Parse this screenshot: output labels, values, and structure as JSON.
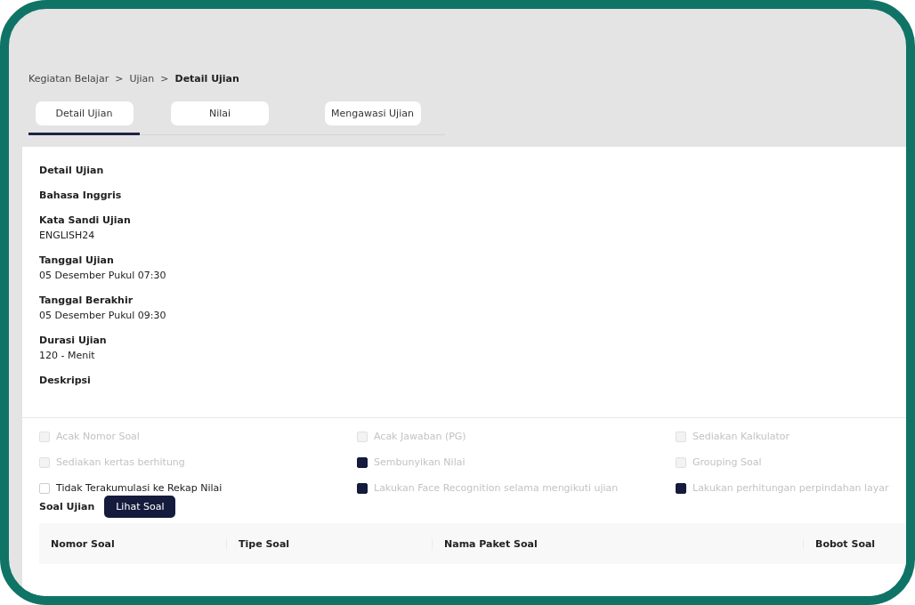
{
  "breadcrumb": [
    {
      "label": "Kegiatan Belajar",
      "current": false
    },
    {
      "label": "Ujian",
      "current": false
    },
    {
      "label": "Detail Ujian",
      "current": true
    }
  ],
  "breadcrumb_separator": ">",
  "tabs": [
    {
      "label": "Detail Ujian",
      "selected": true
    },
    {
      "label": "Nilai",
      "selected": false
    },
    {
      "label": "Mengawasi Ujian",
      "selected": false
    }
  ],
  "detail": {
    "heading": "Detail Ujian",
    "subject": "Bahasa Inggris",
    "fields": [
      {
        "label": "Kata Sandi Ujian",
        "value": "ENGLISH24"
      },
      {
        "label": "Tanggal Ujian",
        "value": "05 Desember Pukul 07:30"
      },
      {
        "label": "Tanggal Berakhir",
        "value": "05 Desember Pukul 09:30"
      },
      {
        "label": "Durasi Ujian",
        "value": "120 - Menit"
      },
      {
        "label": "Deskripsi"
      }
    ]
  },
  "options": [
    {
      "label": "Acak Nomor Soal",
      "checked": false,
      "disabled": true
    },
    {
      "label": "Acak Jawaban (PG)",
      "checked": false,
      "disabled": true
    },
    {
      "label": "Sediakan Kalkulator",
      "checked": false,
      "disabled": true
    },
    {
      "label": "Sediakan kertas berhitung",
      "checked": false,
      "disabled": true
    },
    {
      "label": "Sembunyikan Nilai",
      "checked": true,
      "disabled": true
    },
    {
      "label": "Grouping Soal",
      "checked": false,
      "disabled": true
    },
    {
      "label": "Tidak Terakumulasi ke Rekap Nilai",
      "checked": false,
      "disabled": false
    },
    {
      "label": "Lakukan Face Recognition selama mengikuti ujian",
      "checked": true,
      "disabled": true
    },
    {
      "label": "Lakukan perhitungan perpindahan layar",
      "checked": true,
      "disabled": true
    }
  ],
  "questions": {
    "title": "Soal Ujian",
    "button": "Lihat Soal",
    "table": {
      "columns": [
        "Nomor Soal",
        "Tipe Soal",
        "Nama Paket Soal",
        "Bobot Soal"
      ]
    }
  }
}
